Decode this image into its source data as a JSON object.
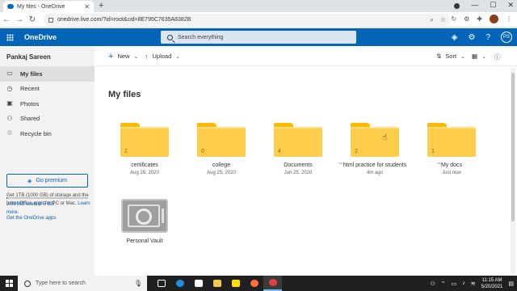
{
  "browser": {
    "tab_title": "My files - OneDrive",
    "url": "onedrive.live.com/?id=root&cid=8E795C7635A8382B"
  },
  "header": {
    "app_name": "OneDrive",
    "search_placeholder": "Search everything",
    "avatar_initials": "PS"
  },
  "sidebar": {
    "user_name": "Pankaj Sareen",
    "items": [
      {
        "label": "My files",
        "icon": "folder-icon",
        "active": true
      },
      {
        "label": "Recent",
        "icon": "clock-icon",
        "active": false
      },
      {
        "label": "Photos",
        "icon": "photo-icon",
        "active": false
      },
      {
        "label": "Shared",
        "icon": "people-icon",
        "active": false
      },
      {
        "label": "Recycle bin",
        "icon": "trash-icon",
        "active": false
      }
    ],
    "promo_text": "Get 1TB (1000 GB) of storage and the latest Office apps for PC or Mac.",
    "promo_link": "Learn more.",
    "premium_label": "Go premium",
    "storage_text": "2.09 MB used of 5 GB",
    "storage_fraction": 0.0004,
    "get_apps": "Get the OneDrive apps"
  },
  "commands": {
    "new_label": "New",
    "upload_label": "Upload",
    "sort_label": "Sort"
  },
  "main": {
    "title": "My files",
    "folders": [
      {
        "name": "certificates",
        "count": "2",
        "date": "Aug 29, 2020",
        "shared": false
      },
      {
        "name": "college",
        "count": "0",
        "date": "Aug 25, 2020",
        "shared": false
      },
      {
        "name": "Documents",
        "count": "4",
        "date": "Jun 25, 2020",
        "shared": false
      },
      {
        "name": "html practice for students",
        "count": "2",
        "date": "4m ago",
        "shared": true
      },
      {
        "name": "My docs",
        "count": "1",
        "date": "Just now",
        "shared": true
      }
    ],
    "vault_label": "Personal Vault"
  },
  "taskbar": {
    "search_placeholder": "Type here to search",
    "time": "11:15 AM",
    "date": "5/20/2021"
  },
  "colors": {
    "brand_blue": "#0364b8",
    "folder_yellow": "#ffcd4c"
  }
}
